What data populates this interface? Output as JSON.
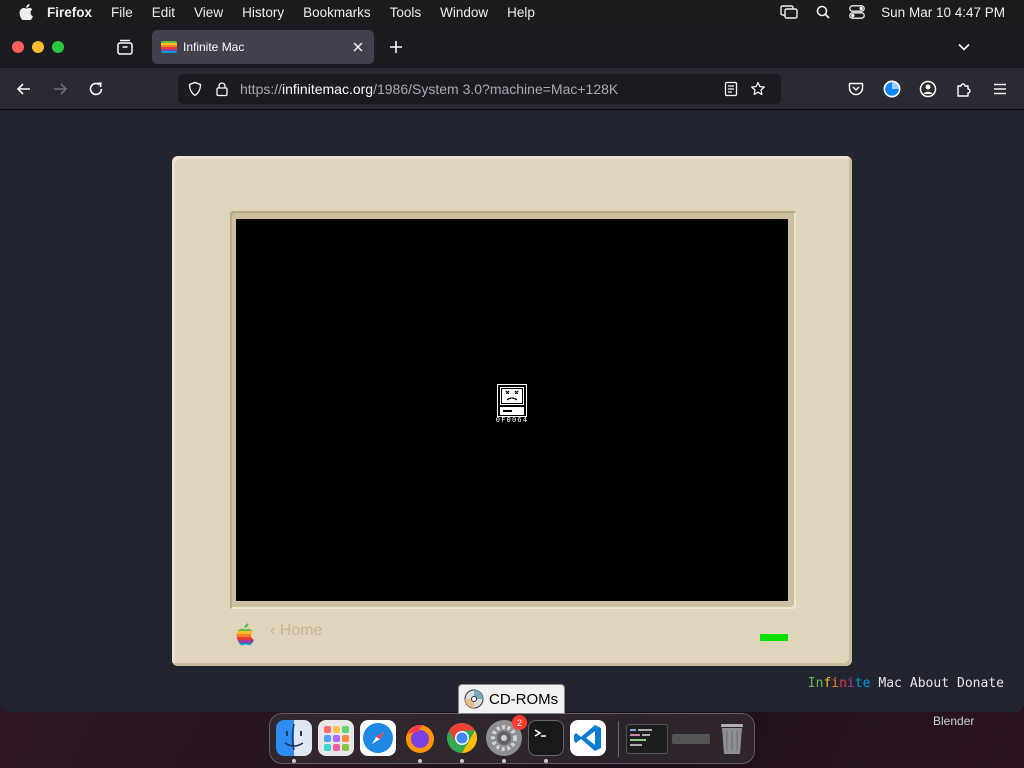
{
  "menubar": {
    "app_name": "Firefox",
    "items": [
      "File",
      "Edit",
      "View",
      "History",
      "Bookmarks",
      "Tools",
      "Window",
      "Help"
    ],
    "clock": "Sun Mar 10  4:47 PM"
  },
  "browser": {
    "tab": {
      "title": "Infinite Mac"
    },
    "url": {
      "scheme": "https://",
      "domain": "infinitemac.org",
      "path": "/1986/System 3.0?machine=Mac+128K"
    }
  },
  "emulator": {
    "error_code": "0F0064",
    "home_link": "‹ Home",
    "power_led_color": "#00e000"
  },
  "site_footer": {
    "brand_letters": [
      "I",
      "n",
      "f",
      "i",
      "n",
      "i",
      "t",
      "e"
    ],
    "brand_colors": [
      "#61bb46",
      "#61bb46",
      "#fdb827",
      "#f5821f",
      "#e03a3e",
      "#963d97",
      "#009ddc",
      "#009ddc"
    ],
    "mac_label": "Mac",
    "about_label": "About",
    "donate_label": "Donate"
  },
  "cdrom_tab": {
    "label": "CD-ROMs"
  },
  "desktop": {
    "window_label": "Blender"
  },
  "dock": {
    "apps": [
      "Finder",
      "Launchpad",
      "Safari",
      "Firefox",
      "Chrome",
      "System Settings",
      "Terminal",
      "Visual Studio Code"
    ],
    "settings_badge": "2"
  }
}
